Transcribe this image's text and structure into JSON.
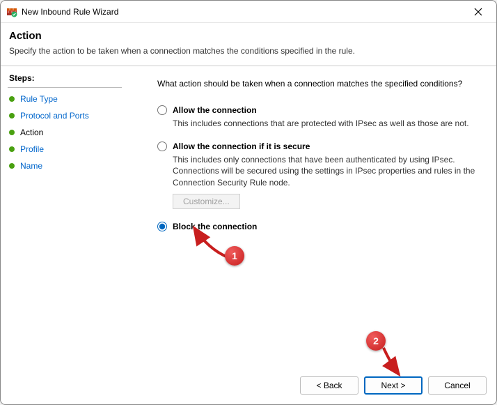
{
  "window": {
    "title": "New Inbound Rule Wizard"
  },
  "header": {
    "heading": "Action",
    "subtitle": "Specify the action to be taken when a connection matches the conditions specified in the rule."
  },
  "steps": {
    "label": "Steps:",
    "items": [
      {
        "label": "Rule Type",
        "current": false
      },
      {
        "label": "Protocol and Ports",
        "current": false
      },
      {
        "label": "Action",
        "current": true
      },
      {
        "label": "Profile",
        "current": false
      },
      {
        "label": "Name",
        "current": false
      }
    ]
  },
  "content": {
    "question": "What action should be taken when a connection matches the specified conditions?",
    "options": [
      {
        "id": "allow",
        "label": "Allow the connection",
        "desc": "This includes connections that are protected with IPsec as well as those are not.",
        "selected": false
      },
      {
        "id": "allow-secure",
        "label": "Allow the connection if it is secure",
        "desc": "This includes only connections that have been authenticated by using IPsec.  Connections will be secured using the settings in IPsec properties and rules in the Connection Security Rule node.",
        "selected": false,
        "customize_label": "Customize..."
      },
      {
        "id": "block",
        "label": "Block the connection",
        "desc": "",
        "selected": true
      }
    ]
  },
  "footer": {
    "back": "< Back",
    "next": "Next >",
    "cancel": "Cancel"
  },
  "annotations": {
    "badge1": "1",
    "badge2": "2"
  }
}
